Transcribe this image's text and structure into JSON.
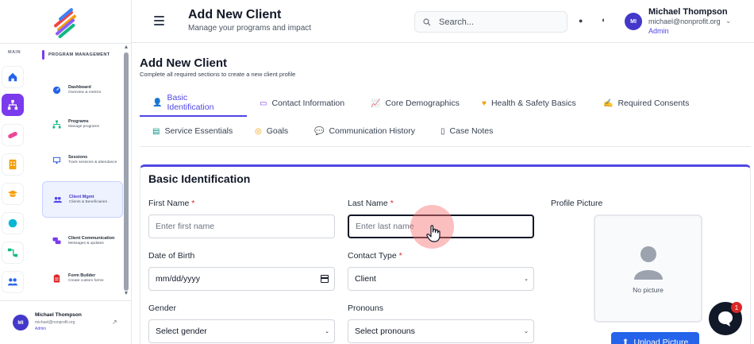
{
  "sidebar": {
    "rail_label": "MAIN",
    "section_label": "PROGRAM MANAGEMENT",
    "items": [
      {
        "title": "Dashboard",
        "subtitle": "Overview & metrics"
      },
      {
        "title": "Programs",
        "subtitle": "Manage programs"
      },
      {
        "title": "Sessions",
        "subtitle": "Track sessions & attendance"
      },
      {
        "title": "Client Mgmt",
        "subtitle": "Clients & Beneficiaries"
      },
      {
        "title": "Client Communication",
        "subtitle": "Messages & updates"
      },
      {
        "title": "Form Builder",
        "subtitle": "Create custom forms"
      }
    ],
    "user": {
      "initials": "MI",
      "name": "Michael Thompson",
      "email": "michael@nonprofit.org",
      "role": "Admin"
    }
  },
  "header": {
    "title": "Add New Client",
    "subtitle": "Manage your programs and impact",
    "search_placeholder": "Search...",
    "user": {
      "initials": "MI",
      "name": "Michael Thompson",
      "email": "michael@nonprofit.org",
      "role": "Admin"
    }
  },
  "main": {
    "title": "Add New Client",
    "subtitle": "Complete all required sections to create a new client profile",
    "tabs": [
      {
        "label": "Basic Identification",
        "icon": "user-icon",
        "active": true
      },
      {
        "label": "Contact Information",
        "icon": "id-card-icon"
      },
      {
        "label": "Core Demographics",
        "icon": "chart-icon"
      },
      {
        "label": "Health & Safety Basics",
        "icon": "heart-icon"
      },
      {
        "label": "Required Consents",
        "icon": "signature-icon"
      },
      {
        "label": "Service Essentials",
        "icon": "clipboard-icon"
      },
      {
        "label": "Goals",
        "icon": "target-icon"
      },
      {
        "label": "Communication History",
        "icon": "comments-icon"
      },
      {
        "label": "Case Notes",
        "icon": "file-icon"
      }
    ],
    "section": {
      "title": "Basic Identification",
      "first_name": {
        "label": "First Name",
        "placeholder": "Enter first name"
      },
      "last_name": {
        "label": "Last Name",
        "placeholder": "Enter last name"
      },
      "dob": {
        "label": "Date of Birth",
        "placeholder": "mm/dd/yyyy"
      },
      "contact_type": {
        "label": "Contact Type",
        "value": "Client"
      },
      "gender": {
        "label": "Gender",
        "value": "Select gender"
      },
      "pronouns": {
        "label": "Pronouns",
        "value": "Select pronouns"
      },
      "profile_picture": {
        "label": "Profile Picture",
        "empty_text": "No picture",
        "upload_label": "Upload Picture"
      }
    },
    "required_mark": "*"
  },
  "chat": {
    "badge": "1"
  },
  "colors": {
    "accent": "#4f46e5",
    "brand": "#7c3aed",
    "danger": "#dc2626",
    "upload": "#2563eb"
  }
}
